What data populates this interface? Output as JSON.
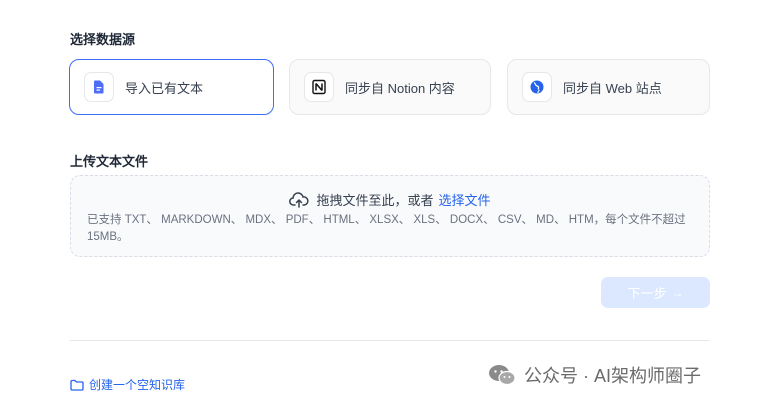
{
  "sections": {
    "choose_source": "选择数据源",
    "upload_title": "上传文本文件"
  },
  "sources": {
    "import_text": {
      "label": "导入已有文本",
      "icon": "file-text-icon",
      "accent": "#4f6ef7"
    },
    "notion": {
      "label": "同步自 Notion 内容",
      "icon": "notion-icon"
    },
    "web": {
      "label": "同步自 Web 站点",
      "icon": "web-globe-icon",
      "accent": "#2563eb"
    }
  },
  "upload": {
    "icon": "cloud-upload-icon",
    "drag_text": "拖拽文件至此，或者",
    "select_link": "选择文件",
    "supported": "已支持 TXT、 MARKDOWN、 MDX、 PDF、 HTML、 XLSX、 XLS、 DOCX、 CSV、 MD、 HTM，每个文件不超过 15MB。"
  },
  "next_button": {
    "label": "下一步",
    "arrow": "→"
  },
  "create_empty": {
    "label": "创建一个空知识库",
    "icon": "folder-icon"
  },
  "watermark": {
    "text": "公众号 · AI架构师圈子",
    "icon": "wechat-icon"
  },
  "colors": {
    "primary": "#3b6ff5",
    "link": "#2563eb",
    "disabled_button": "#dbe8ff"
  }
}
